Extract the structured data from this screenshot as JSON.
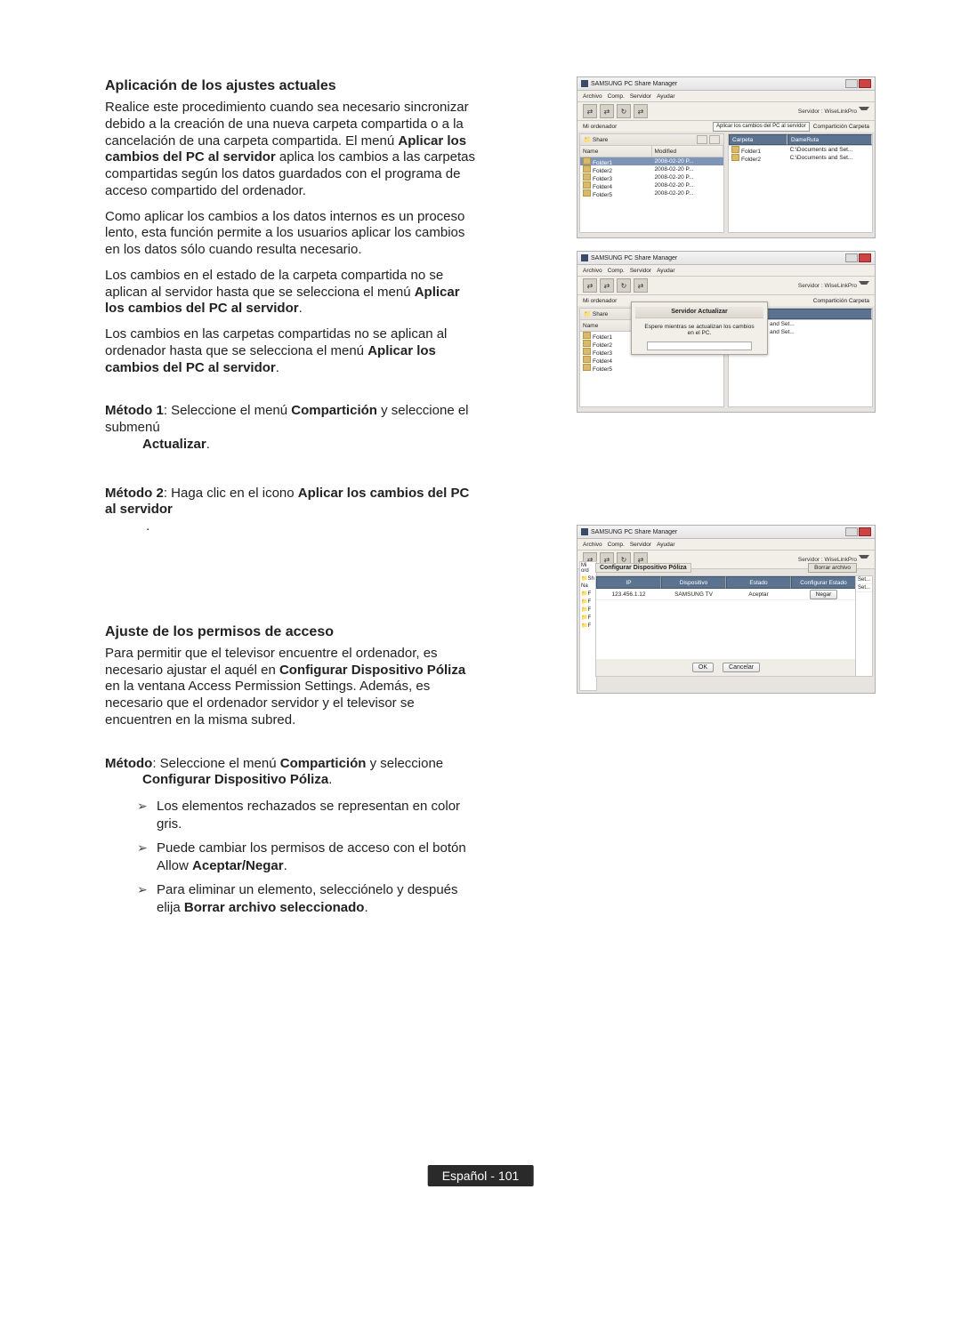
{
  "sections": {
    "applySettings": {
      "title": "Aplicación de los ajustes actuales",
      "p1a": "Realice este procedimiento cuando sea necesario sincronizar debido a la creación de una nueva carpeta compartida o a la cancelación de una carpeta compartida. El menú ",
      "p1b_bold": "Aplicar los cambios del PC al servidor",
      "p1c": " aplica los cambios a las carpetas compartidas según los datos guardados con el programa de acceso compartido del ordenador.",
      "p2": "Como aplicar los cambios a los datos internos es un proceso lento, esta función permite a los usuarios aplicar los cambios en los datos sólo cuando resulta necesario.",
      "p3a": "Los cambios en el estado de la carpeta compartida no se aplican al servidor hasta que se selecciona el menú ",
      "p3b_bold": "Aplicar los cambios del PC al servidor",
      "p3c": ".",
      "p4a": "Los cambios en las carpetas compartidas no se aplican al ordenador hasta que se selecciona el menú ",
      "p4b_bold": "Aplicar los cambios del PC al servidor",
      "p4c": ".",
      "m1_label": "Método 1",
      "m1_text1": ": Seleccione el menú ",
      "m1_bold1": "Compartición",
      "m1_text2": " y seleccione el submenú ",
      "m1_bold2": "Actualizar",
      "m1_text3": ".",
      "m2_label": "Método 2",
      "m2_text1": ": Haga clic en el icono ",
      "m2_bold1": "Aplicar los cambios del PC al servidor",
      "m2_text2": "."
    },
    "accessPerm": {
      "title": "Ajuste de los permisos de acceso",
      "p1a": "Para permitir que el televisor encuentre el ordenador, es necesario ajustar el aquél en ",
      "p1b_bold": "Configurar Dispositivo Póliza",
      "p1c": " en la ventana Access Permission Settings. Además, es necesario que el ordenador servidor y el televisor se encuentren en la misma subred.",
      "m_label": "Método",
      "m_text1": ": Seleccione el menú ",
      "m_bold1": "Compartición",
      "m_text2": " y seleccione ",
      "m_bold2": "Configurar Dispositivo Póliza",
      "m_text3": ".",
      "li1": "Los elementos rechazados se representan en color gris.",
      "li2a": "Puede cambiar los permisos de acceso con el botón Allow ",
      "li2b_bold": "Aceptar/Negar",
      "li2c": ".",
      "li3a": "Para eliminar un elemento, selecciónelo y después elija ",
      "li3b_bold": "Borrar archivo seleccionado",
      "li3c": "."
    }
  },
  "screenshots": {
    "common": {
      "app_title": "SAMSUNG PC Share Manager",
      "menus": [
        "Archivo",
        "Comp.",
        "Servidor",
        "Ayudar"
      ],
      "server_label": "Servidor : WiseLinkPro",
      "tooltip_apply": "Aplicar los cambios del PC al servidor",
      "mi_ordenador": "Mi ordenador",
      "comparticion_carpeta": "Compartición Carpeta",
      "share_label": "Share",
      "col_name": "Name",
      "col_modified": "Modified",
      "col_carpeta": "Carpeta",
      "col_dameruta": "DameRuta",
      "folders": [
        "Folder1",
        "Folder2",
        "Folder3",
        "Folder4",
        "Folder5"
      ],
      "dates": [
        "2008-02-20 P...",
        "2008-02-20 P...",
        "2008-02-20 P...",
        "2008-02-20 P...",
        "2008-02-20 P..."
      ],
      "shared": [
        "Folder1",
        "Folder2"
      ],
      "ruta": "C:\\Documents and Set..."
    },
    "shot2": {
      "dlg_title": "Servidor Actualizar",
      "dlg_body": "Espere mientras se actualizan los cambios en el PC."
    },
    "shot3": {
      "ord_label": "Mi ord",
      "sh_label": "Sh",
      "dlg_title": "Configurar Dispositivo Póliza",
      "del_btn": "Borrar archivo",
      "head_ip": "IP",
      "head_disp": "Dispositivo",
      "head_estado": "Estado",
      "head_conf": "Configurar Estado",
      "row_ip": "123.456.1.12",
      "row_disp": "SAMSUNG TV",
      "row_estado": "Aceptar",
      "row_btn": "Negar",
      "ok": "OK",
      "cancel": "Cancelar",
      "set": "Set..."
    }
  },
  "footer": {
    "lang": "Español",
    "sep": " - ",
    "page": "101"
  }
}
